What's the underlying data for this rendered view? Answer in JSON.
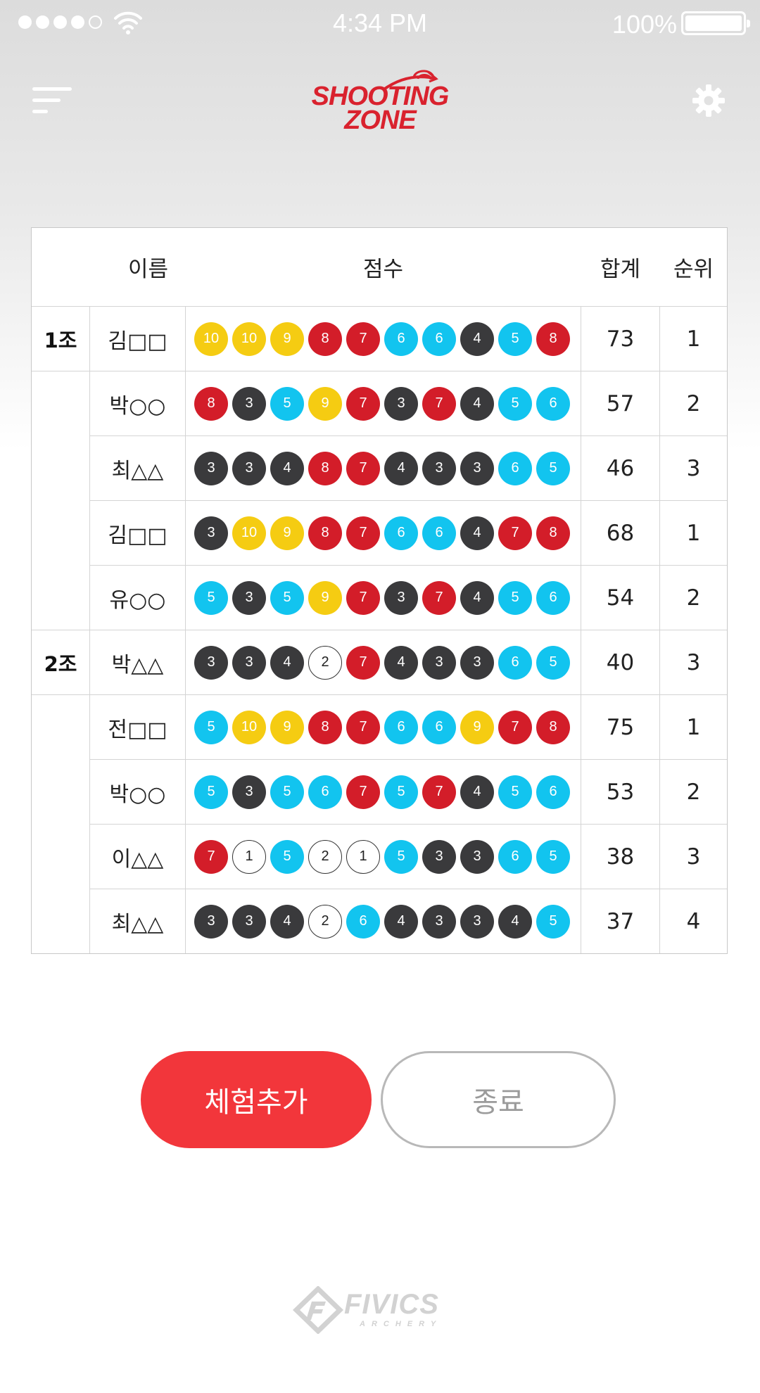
{
  "status_bar": {
    "time": "4:34 PM",
    "battery": "100%"
  },
  "header": {
    "logo_line1": "SHOOTING",
    "logo_line2": "ZONE",
    "menu_icon": "hamburger-menu-icon",
    "settings_icon": "gear-icon"
  },
  "table": {
    "headers": {
      "name": "이름",
      "scores": "점수",
      "total": "합계",
      "rank": "순위"
    },
    "colors": {
      "yellow": "#f5cc12",
      "red": "#d31d29",
      "blue": "#12c4ef",
      "black": "#3a3a3c",
      "white": "#ffffff"
    },
    "rows": [
      {
        "group": "1조",
        "name": "김□□",
        "scores": [
          10,
          10,
          9,
          8,
          7,
          6,
          6,
          4,
          5,
          8
        ],
        "total": "73",
        "rank": "1"
      },
      {
        "group": "",
        "name": "박○○",
        "scores": [
          8,
          3,
          5,
          9,
          7,
          3,
          7,
          4,
          5,
          6
        ],
        "total": "57",
        "rank": "2"
      },
      {
        "group": "",
        "name": "최△△",
        "scores": [
          3,
          3,
          4,
          8,
          7,
          4,
          3,
          3,
          6,
          5
        ],
        "total": "46",
        "rank": "3"
      },
      {
        "group": "",
        "name": "김□□",
        "scores": [
          3,
          10,
          9,
          8,
          7,
          6,
          6,
          4,
          7,
          8
        ],
        "total": "68",
        "rank": "1"
      },
      {
        "group": "",
        "name": "유○○",
        "scores": [
          5,
          3,
          5,
          9,
          7,
          3,
          7,
          4,
          5,
          6
        ],
        "total": "54",
        "rank": "2"
      },
      {
        "group": "2조",
        "name": "박△△",
        "scores": [
          3,
          3,
          4,
          2,
          7,
          4,
          3,
          3,
          6,
          5
        ],
        "total": "40",
        "rank": "3"
      },
      {
        "group": "",
        "name": "전□□",
        "scores": [
          5,
          10,
          9,
          8,
          7,
          6,
          6,
          9,
          7,
          8
        ],
        "total": "75",
        "rank": "1"
      },
      {
        "group": "",
        "name": "박○○",
        "scores": [
          5,
          3,
          5,
          6,
          7,
          5,
          7,
          4,
          5,
          6
        ],
        "total": "53",
        "rank": "2"
      },
      {
        "group": "",
        "name": "이△△",
        "scores": [
          7,
          1,
          5,
          2,
          1,
          5,
          3,
          3,
          6,
          5
        ],
        "total": "38",
        "rank": "3"
      },
      {
        "group": "",
        "name": "최△△",
        "scores": [
          3,
          3,
          4,
          2,
          6,
          4,
          3,
          3,
          4,
          5
        ],
        "total": "37",
        "rank": "4"
      }
    ]
  },
  "buttons": {
    "add_label": "체험추가",
    "end_label": "종료"
  },
  "footer": {
    "brand": "FIVICS",
    "sub": "ARCHERY"
  }
}
